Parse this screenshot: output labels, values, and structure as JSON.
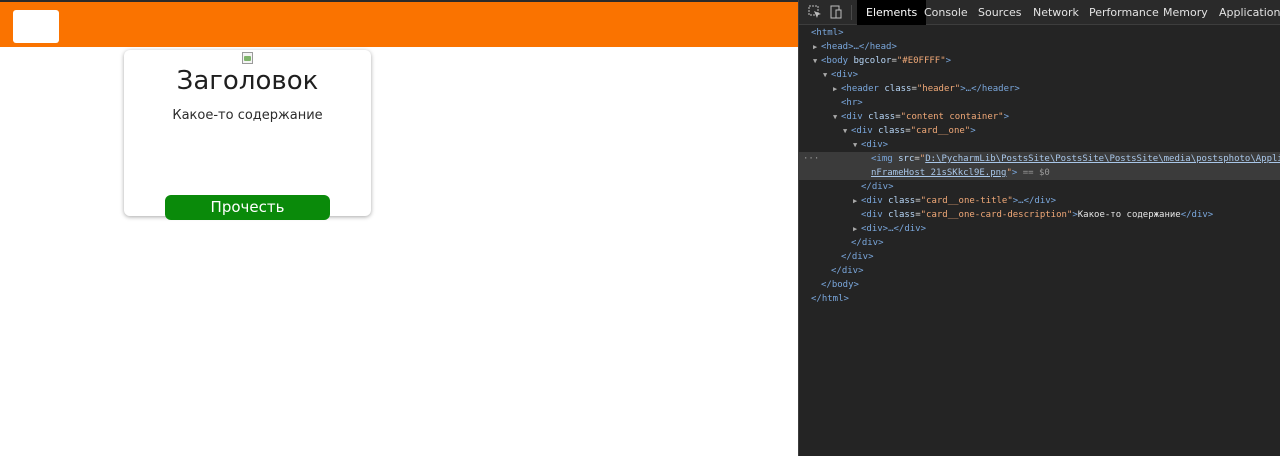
{
  "colors": {
    "header_bg": "#fa7300",
    "button_bg": "#0a8a0a",
    "card_bg": "#ffffff",
    "devtools_bg": "#242424"
  },
  "page": {
    "card": {
      "image_icon": "broken-image-icon",
      "title": "Заголовок",
      "description": "Какое-то содержание",
      "button_label": "Прочесть"
    }
  },
  "devtools": {
    "tabs": [
      "Elements",
      "Console",
      "Sources",
      "Network",
      "Performance",
      "Memory",
      "Application"
    ],
    "active_tab": "Elements",
    "tree": {
      "html_open": "<html>",
      "head": "<head>…</head>",
      "body_open_tag": "<body",
      "body_attr": "bgcolor",
      "body_attr_val": "\"#E0FFFF\"",
      "div_open": "<div>",
      "header_tag": "<header",
      "header_class": "\"header\"",
      "header_rest": ">…</header>",
      "hr": "<hr>",
      "content_class": "\"content container\"",
      "card_class": "\"card__one\"",
      "div_plain": "<div>",
      "img_src_1": "D:\\PycharmLib\\PostsSite\\PostsSite\\PostsSite\\media\\postsphoto\\Appli",
      "img_src_2": "nFrameHost_21sSKkcl9E.png",
      "img_tail": " == $0",
      "div_close": "</div>",
      "title_class": "\"card__one-title\"",
      "title_rest": ">…</div>",
      "desc_class": "\"card__one-card-description\"",
      "desc_text": "Какое-то содержание",
      "collapsed_div": "<div>…</div>",
      "body_close": "</body>",
      "html_close": "</html>"
    }
  }
}
